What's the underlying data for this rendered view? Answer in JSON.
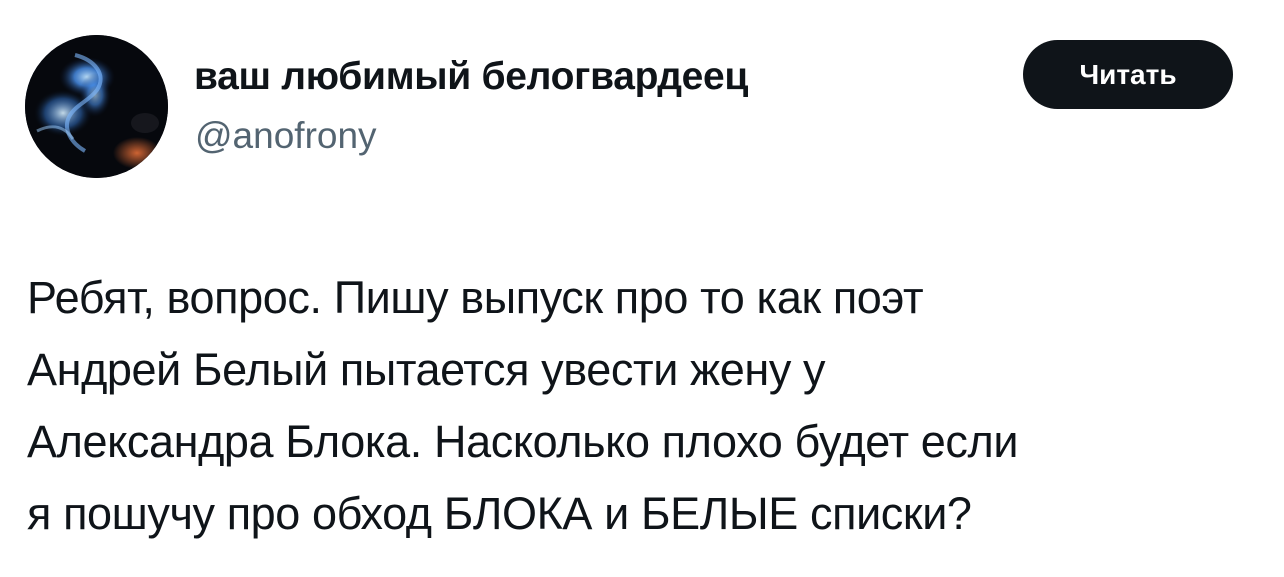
{
  "author": {
    "display_name": "ваш любимый белогвардеец",
    "handle": "@anofrony",
    "avatar_icon": "avatar-photo"
  },
  "follow_button": {
    "label": "Читать"
  },
  "tweet": {
    "lines": [
      "Ребят, вопрос. Пишу выпуск про то как поэт",
      "Андрей Белый пытается увести жену у",
      "Александра Блока. Насколько плохо будет если",
      "я пошучу про обход БЛОКА и БЕЛЫЕ списки?"
    ]
  },
  "colors": {
    "text": "#0f1419",
    "secondary_text": "#536471",
    "button_bg": "#0f1419",
    "button_text": "#ffffff",
    "background": "#ffffff"
  }
}
